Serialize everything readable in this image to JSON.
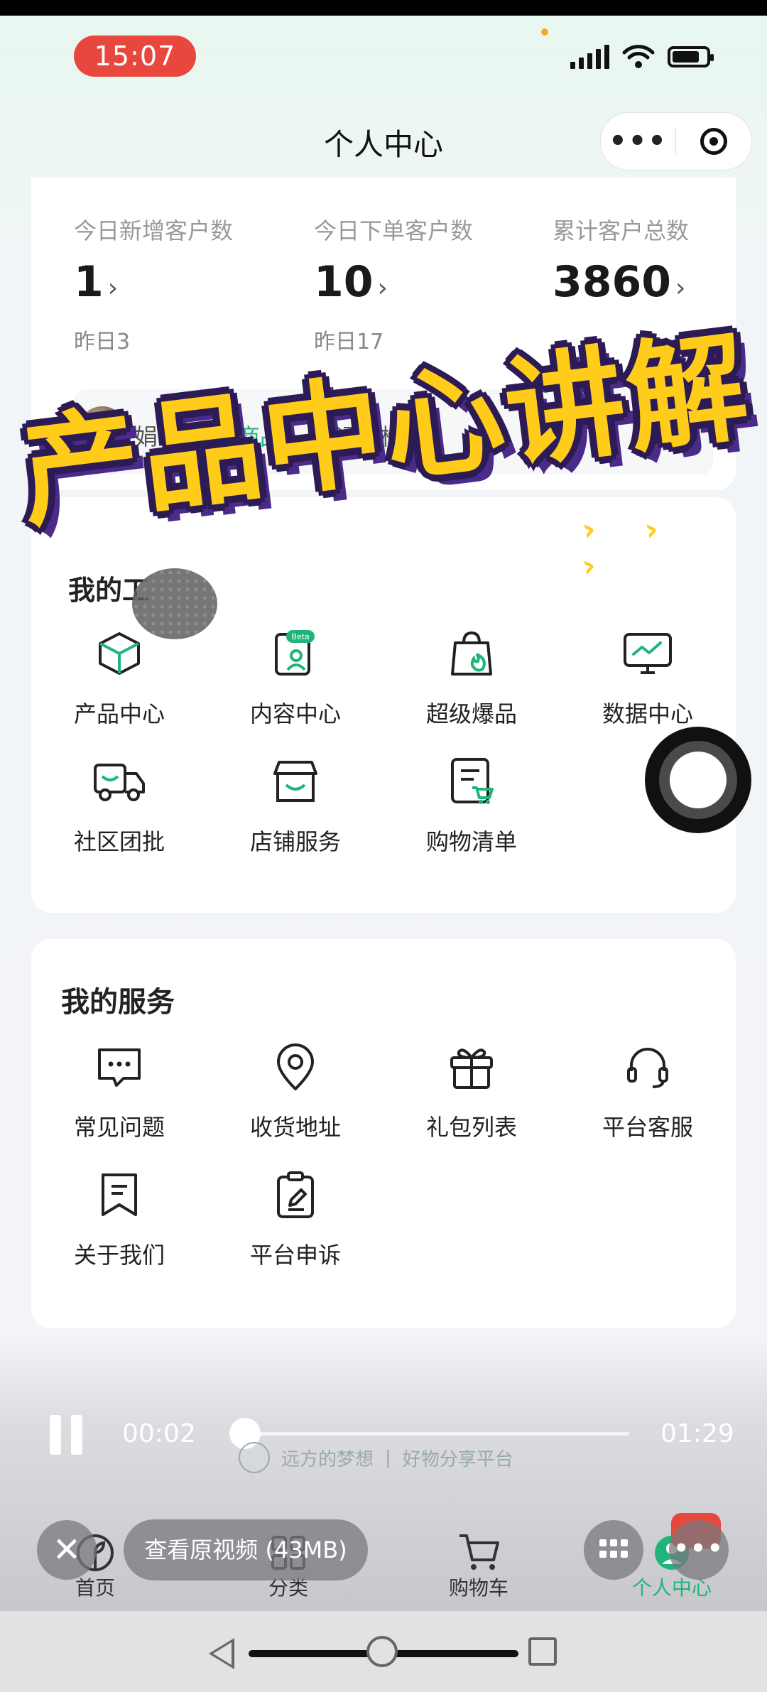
{
  "status_bar": {
    "time": "15:07"
  },
  "header": {
    "title": "个人中心",
    "more_label": "•••"
  },
  "stats_card": {
    "stats": [
      {
        "label": "今日新增客户数",
        "value": "1",
        "sub": "昨日3"
      },
      {
        "label": "今日下单客户数",
        "value": "10",
        "sub": "昨日17"
      },
      {
        "label": "累计客户总数",
        "value": "3860"
      }
    ],
    "arrow": "›",
    "news": {
      "user": "娟*",
      "action": "加购了商品",
      "product": "【远方检"
    }
  },
  "overlay": {
    "title": "产品中心讲解",
    "chevron": "›"
  },
  "tools_card": {
    "partial_title": "我的工",
    "items": [
      {
        "label": "产品中心",
        "icon": "cube-icon"
      },
      {
        "label": "内容中心",
        "icon": "content-beta-icon",
        "badge": "Beta"
      },
      {
        "label": "超级爆品",
        "icon": "hot-bag-icon"
      },
      {
        "label": "数据中心",
        "icon": "monitor-chart-icon"
      },
      {
        "label": "社区团批",
        "icon": "delivery-truck-icon"
      },
      {
        "label": "店铺服务",
        "icon": "shop-icon"
      },
      {
        "label": "购物清单",
        "icon": "shopping-list-icon"
      }
    ]
  },
  "services_card": {
    "title": "我的服务",
    "items": [
      {
        "label": "常见问题",
        "icon": "chat-bubble-icon"
      },
      {
        "label": "收货地址",
        "icon": "location-pin-icon"
      },
      {
        "label": "礼包列表",
        "icon": "gift-icon"
      },
      {
        "label": "平台客服",
        "icon": "headset-icon"
      },
      {
        "label": "关于我们",
        "icon": "bookmark-icon"
      },
      {
        "label": "平台申诉",
        "icon": "clipboard-edit-icon"
      }
    ]
  },
  "video": {
    "current_time": "00:02",
    "total_time": "01:29",
    "progress": 0.02,
    "watermark_brand": "远方的梦想",
    "watermark_tagline": "好物分享平台",
    "view_original_label": "查看原视频 (43MB)"
  },
  "tabbar": {
    "tabs": [
      {
        "label": "首页",
        "icon": "home-leaf-icon",
        "active": false
      },
      {
        "label": "分类",
        "icon": "category-icon",
        "active": false
      },
      {
        "label": "购物车",
        "icon": "cart-icon",
        "active": false
      },
      {
        "label": "个人中心",
        "icon": "profile-icon",
        "active": true
      }
    ]
  },
  "colors": {
    "accent": "#1fb57a",
    "overlay_text": "#ffcc1a",
    "overlay_outline": "#2d1b55",
    "time_pill": "#e8473e"
  }
}
